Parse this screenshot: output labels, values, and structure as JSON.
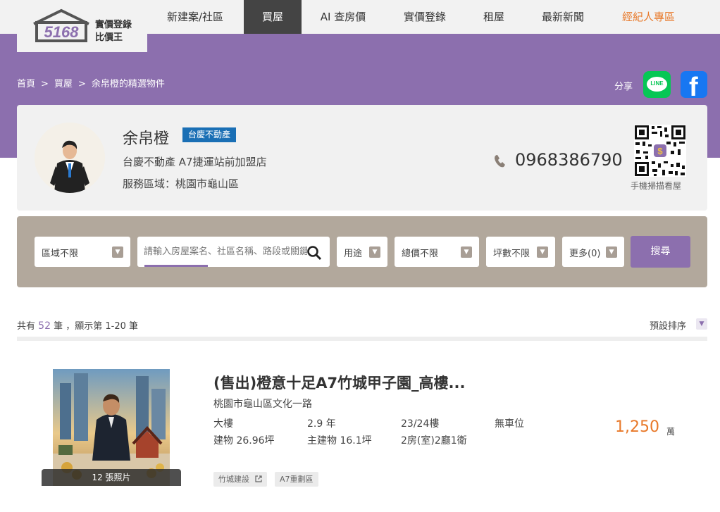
{
  "brand": {
    "logo_number": "5168",
    "name_line1": "實價登錄",
    "name_line2": "比價王"
  },
  "nav": [
    {
      "label": "新建案/社區"
    },
    {
      "label": "買屋"
    },
    {
      "label": "AI 查房價"
    },
    {
      "label": "實價登錄"
    },
    {
      "label": "租屋"
    },
    {
      "label": "最新新聞"
    },
    {
      "label": "經紀人專區"
    }
  ],
  "breadcrumb": [
    "首頁",
    ">",
    "買屋",
    ">",
    "余帛橙的精選物件"
  ],
  "share": {
    "label": "分享",
    "line_label": "LINE",
    "facebook_label": "f"
  },
  "agent": {
    "name": "余帛橙",
    "brand_badge": "台慶不動產",
    "store": "台慶不動產 A7捷運站前加盟店",
    "area": "服務區域：桃園市龜山區",
    "phone": "0968386790",
    "qr_caption": "手機掃描看屋"
  },
  "search": {
    "region": "區域不限",
    "keyword_placeholder": "請輸入房屋案名、社區名稱、路段或關鍵字",
    "usage": "用途",
    "price": "總價不限",
    "size": "坪數不限",
    "more": "更多(0)",
    "submit": "搜尋"
  },
  "results": {
    "prefix": "共有",
    "total": "52",
    "middle": "筆 ，顯示第 1-20 筆",
    "sort": "預設排序"
  },
  "listing": {
    "title": "(售出)橙意十足A7竹城甲子園_高樓...",
    "address": "桃園市龜山區文化一路",
    "specs": [
      "大樓",
      "2.9 年",
      "23/24樓",
      "無車位",
      "建物 26.96坪",
      "主建物 16.1坪",
      "2房(室)2廳1衛"
    ],
    "price": "1,250",
    "price_unit": "萬",
    "photo_count": "12 張照片",
    "tags": [
      "竹城建設",
      "A7重劃區"
    ]
  },
  "colors": {
    "purple": "#8c6fae",
    "orange": "#e8792a",
    "line_green": "#06c755",
    "facebook_blue": "#1877f2",
    "badge_blue": "#1a6fb5"
  }
}
